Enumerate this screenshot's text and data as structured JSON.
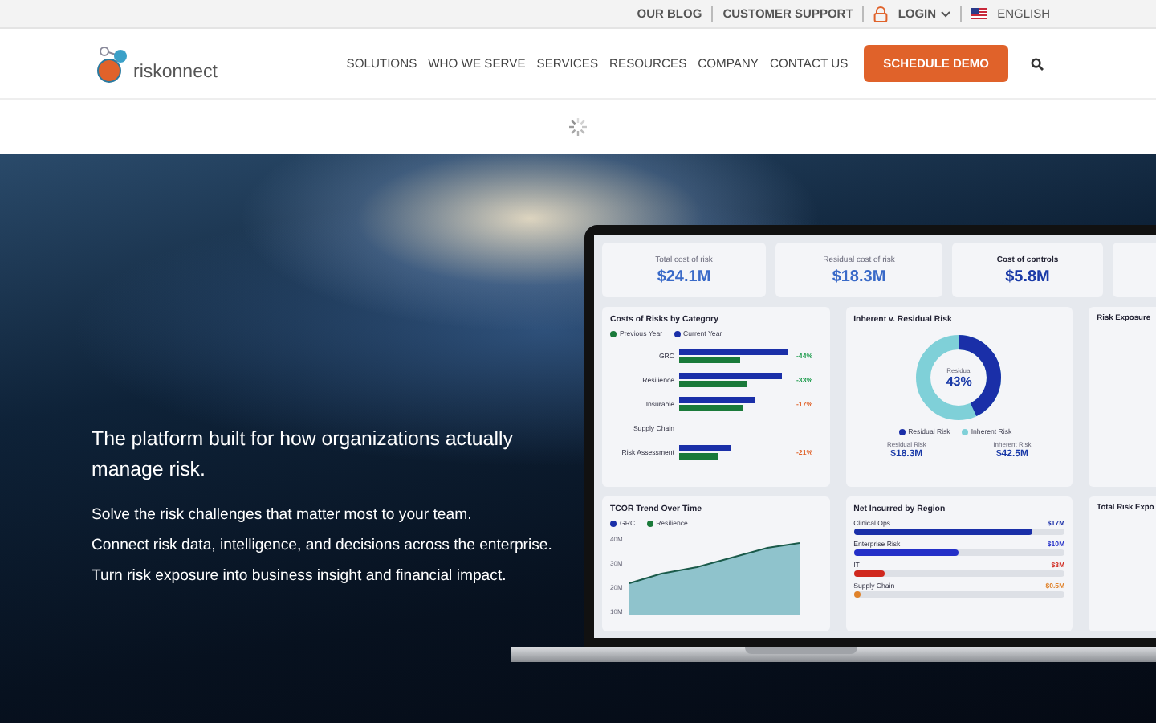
{
  "top_bar": {
    "links": [
      {
        "label": "OUR BLOG",
        "kind": "link"
      },
      {
        "label": "CUSTOMER SUPPORT",
        "kind": "link"
      },
      {
        "label": "LOGIN",
        "kind": "login"
      },
      {
        "label": "ENGLISH",
        "kind": "language"
      }
    ]
  },
  "nav": {
    "logo": "riskonnect",
    "items": [
      "SOLUTIONS",
      "WHO WE SERVE",
      "SERVICES",
      "RESOURCES",
      "COMPANY",
      "CONTACT US"
    ],
    "cta": "SCHEDULE DEMO"
  },
  "hero": {
    "headline": "The platform built for how organizations actually manage risk.",
    "lines": [
      "Solve the risk challenges that matter most to your team.",
      "Connect risk data, intelligence, and decisions across the enterprise.",
      "Turn risk exposure into business insight and financial impact."
    ]
  },
  "dashboard": {
    "kpis": [
      {
        "label": "Total cost of risk",
        "value": "$24.1M"
      },
      {
        "label": "Residual cost of risk",
        "value": "$18.3M"
      },
      {
        "label": "Cost of controls",
        "value": "$5.8M"
      }
    ],
    "costs": {
      "title": "Costs of Risks by Category",
      "legend": [
        {
          "label": "Previous Year",
          "color": "#1a7a3a"
        },
        {
          "label": "Current Year",
          "color": "#1a2fa8"
        }
      ],
      "rows": [
        {
          "label": "GRC",
          "change": "-44%",
          "kind": "good"
        },
        {
          "label": "Resilience",
          "change": "-33%",
          "kind": "good"
        },
        {
          "label": "Insurable",
          "change": "-17%",
          "kind": "warn"
        },
        {
          "label": "Supply Chain",
          "kind": "blank"
        },
        {
          "label": "Risk Assessment",
          "change": "-21%",
          "kind": "warn"
        }
      ]
    },
    "donut": {
      "title": "Inherent v. Residual Risk",
      "center_label": "Residual",
      "center_value": "43%",
      "legend": [
        {
          "label": "Residual Risk",
          "color": "#1a2fa8"
        },
        {
          "label": "Inherent Risk",
          "color": "#7fd0d8"
        }
      ],
      "stats": [
        {
          "label": "Residual Risk",
          "value": "$18.3M"
        },
        {
          "label": "Inherent Risk",
          "value": "$42.5M"
        }
      ]
    },
    "exposure": {
      "title": "Risk Exposure"
    },
    "trend": {
      "title": "TCOR Trend Over Time",
      "legend": [
        {
          "label": "GRC",
          "color": "#1a2fa8"
        },
        {
          "label": "Resilience",
          "color": "#1a7a3a"
        }
      ],
      "yticks": [
        "40M",
        "30M",
        "20M",
        "10M"
      ]
    },
    "regions": {
      "title": "Net Incurred by Region",
      "rows": [
        {
          "label": "Clinical Ops",
          "value": "$17M",
          "level": 0.85,
          "color": "#1a2fa8"
        },
        {
          "label": "Enterprise Risk",
          "value": "$10M",
          "level": 0.5,
          "color": "#2430c8"
        },
        {
          "label": "IT",
          "value": "$3M",
          "level": 0.15,
          "color": "#d0281e"
        },
        {
          "label": "Supply Chain",
          "value": "$0.5M",
          "level": 0.02,
          "color": "#e0822a"
        }
      ]
    },
    "total": {
      "title": "Total Risk Expo"
    }
  }
}
